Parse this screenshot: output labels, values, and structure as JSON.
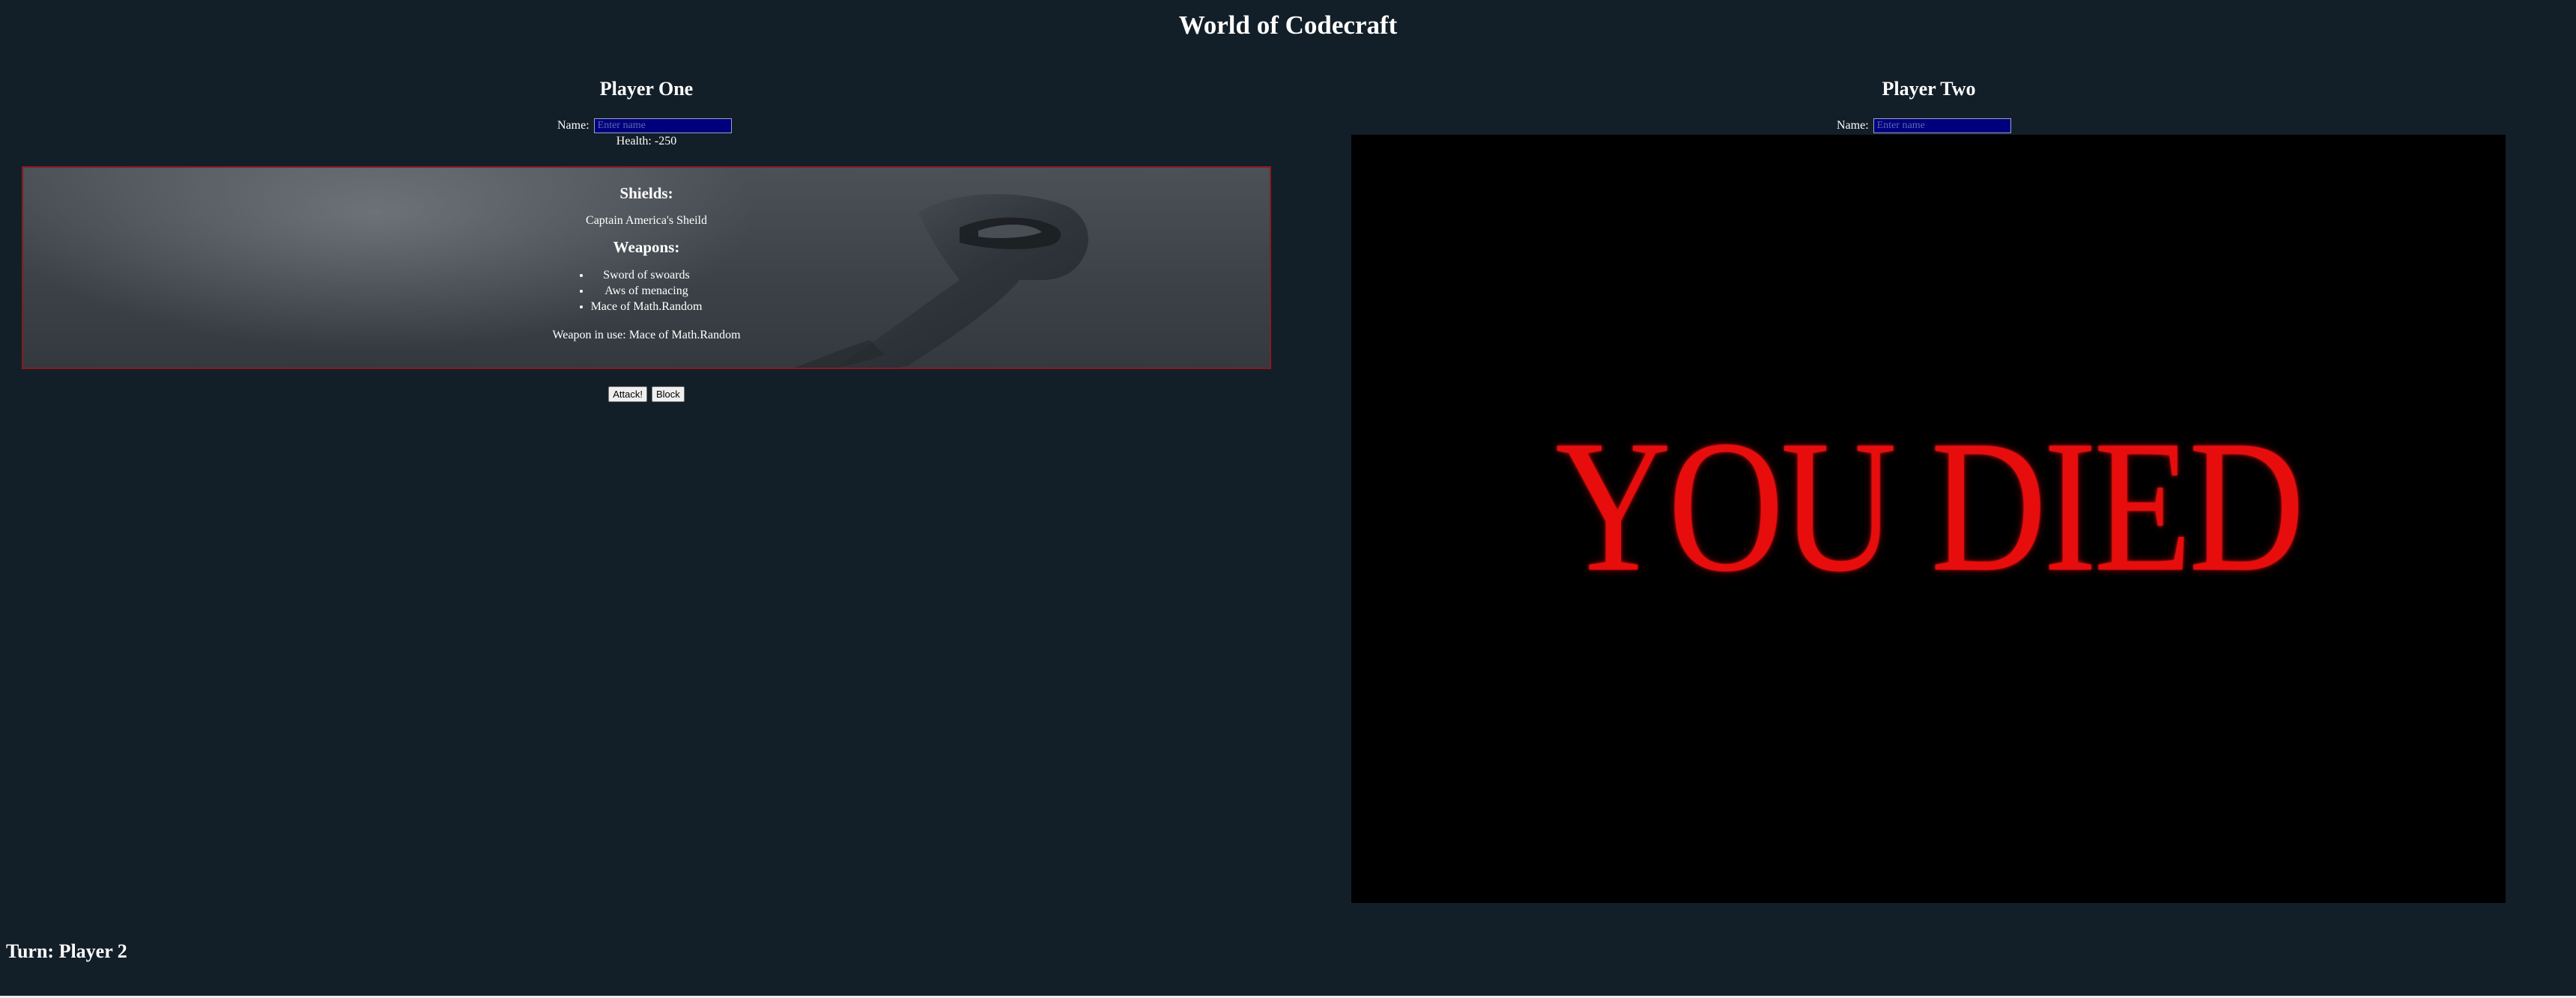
{
  "game": {
    "title": "World of Codecraft"
  },
  "player_one": {
    "title": "Player One",
    "name_label": "Name:",
    "name_value": "",
    "name_placeholder": "Enter name",
    "health_text": "Health: -250",
    "shields_heading": "Shields:",
    "shield": "Captain America's Sheild",
    "weapons_heading": "Weapons:",
    "weapons": [
      "Sword of swoards",
      "Aws of menacing",
      "Mace of Math.Random"
    ],
    "weapon_in_use": "Weapon in use: Mace of Math.Random",
    "attack_label": "Attack!",
    "block_label": "Block"
  },
  "player_two": {
    "title": "Player Two",
    "name_label": "Name:",
    "name_value": "",
    "name_placeholder": "Enter name",
    "death_banner": "YOU DIED"
  },
  "turn": {
    "text": "Turn: Player 2"
  },
  "colors": {
    "background": "#131f28",
    "panel_border": "#8a1a1e",
    "input_background": "#00007c",
    "death_text": "#e80d0d"
  },
  "icons": {
    "inventory_background": "hammer-image"
  }
}
